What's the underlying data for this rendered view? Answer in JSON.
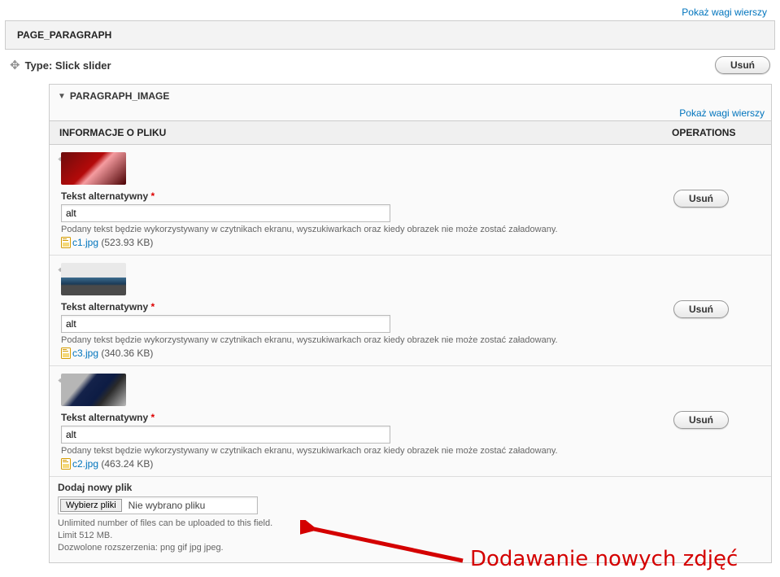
{
  "top_link": "Pokaż wagi wierszy",
  "panel_title": "PAGE_PARAGRAPH",
  "type_label": "Type: Slick slider",
  "btn_delete": "Usuń",
  "inner_title": "PARAGRAPH_IMAGE",
  "inner_link": "Pokaż wagi wierszy",
  "th_info": "INFORMACJE O PLIKU",
  "th_ops": "OPERATIONS",
  "alt_label": "Tekst alternatywny",
  "alt_desc": "Podany tekst będzie wykorzystywany w czytnikach ekranu, wyszukiwarkach oraz kiedy obrazek nie może zostać załadowany.",
  "rows": [
    {
      "alt": "alt",
      "file_name": "c1.jpg",
      "file_size": "(523.93 KB)",
      "thumb_css": "background:linear-gradient(135deg,#6c0c0c,#b40a0a 45%,#f59ca0 55%,#4a0002);"
    },
    {
      "alt": "alt",
      "file_name": "c3.jpg",
      "file_size": "(340.36 KB)",
      "thumb_css": "background:linear-gradient(180deg,#e9e9e9 45%,#3d6c8e 45%,#1b3b58 65%,#4a4a4a 70%);"
    },
    {
      "alt": "alt",
      "file_name": "c2.jpg",
      "file_size": "(463.24 KB)",
      "thumb_css": "background:linear-gradient(130deg,#b6b6b6 30%,#14224a 40%,#0d1c44 60%,#2a2a2a 70%,#bcbcbc);"
    }
  ],
  "upload": {
    "label": "Dodaj nowy plik",
    "btn": "Wybierz pliki",
    "placeholder": "Nie wybrano pliku",
    "note1": "Unlimited number of files can be uploaded to this field.",
    "note2": "Limit 512 MB.",
    "note3": "Dozwolone rozszerzenia: png gif jpg jpeg."
  },
  "annotation_text": "Dodawanie nowych zdjęć"
}
